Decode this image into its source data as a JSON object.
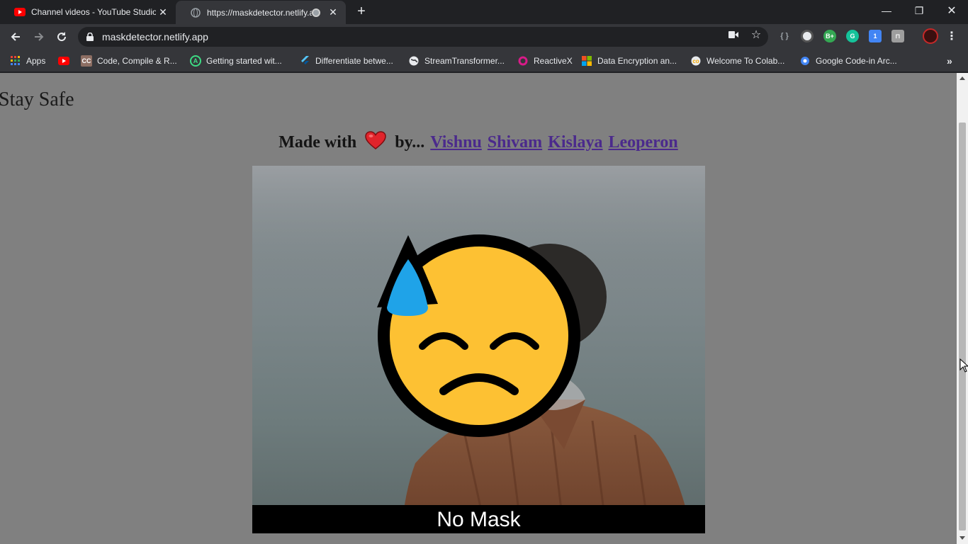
{
  "browser": {
    "tabs": [
      {
        "title": "Channel videos - YouTube Studio",
        "active": false,
        "favicon": "youtube-icon"
      },
      {
        "title": "https://maskdetector.netlify.a",
        "active": true,
        "favicon": "globe-icon"
      }
    ],
    "address": "maskdetector.netlify.app",
    "bookmarks": [
      {
        "label": "Apps",
        "icon": "apps-grid-icon"
      },
      {
        "label": "",
        "icon": "youtube-icon"
      },
      {
        "label": "Code, Compile & R...",
        "icon": "cc-icon"
      },
      {
        "label": "Getting started wit...",
        "icon": "android-studio-icon"
      },
      {
        "label": "Differentiate betwe...",
        "icon": "flutter-icon"
      },
      {
        "label": "StreamTransformer...",
        "icon": "globe-icon"
      },
      {
        "label": "ReactiveX",
        "icon": "reactivex-icon"
      },
      {
        "label": "Data Encryption an...",
        "icon": "microsoft-icon"
      },
      {
        "label": "Welcome To Colab...",
        "icon": "colab-icon"
      },
      {
        "label": "Google Code-in Arc...",
        "icon": "gear-icon"
      }
    ],
    "extension_badge": "1"
  },
  "page": {
    "header": "Stay Safe",
    "made_with": "Made with",
    "by": "by...",
    "authors": [
      "Vishnu",
      "Shivam",
      "Kislaya",
      "Leoperon"
    ],
    "status": "No Mask"
  },
  "colors": {
    "page_bg": "#808080",
    "link": "#4b2a8c",
    "emoji_face": "#fdc133",
    "emoji_drop": "#1fa3e8",
    "heart": "#e0242b"
  }
}
